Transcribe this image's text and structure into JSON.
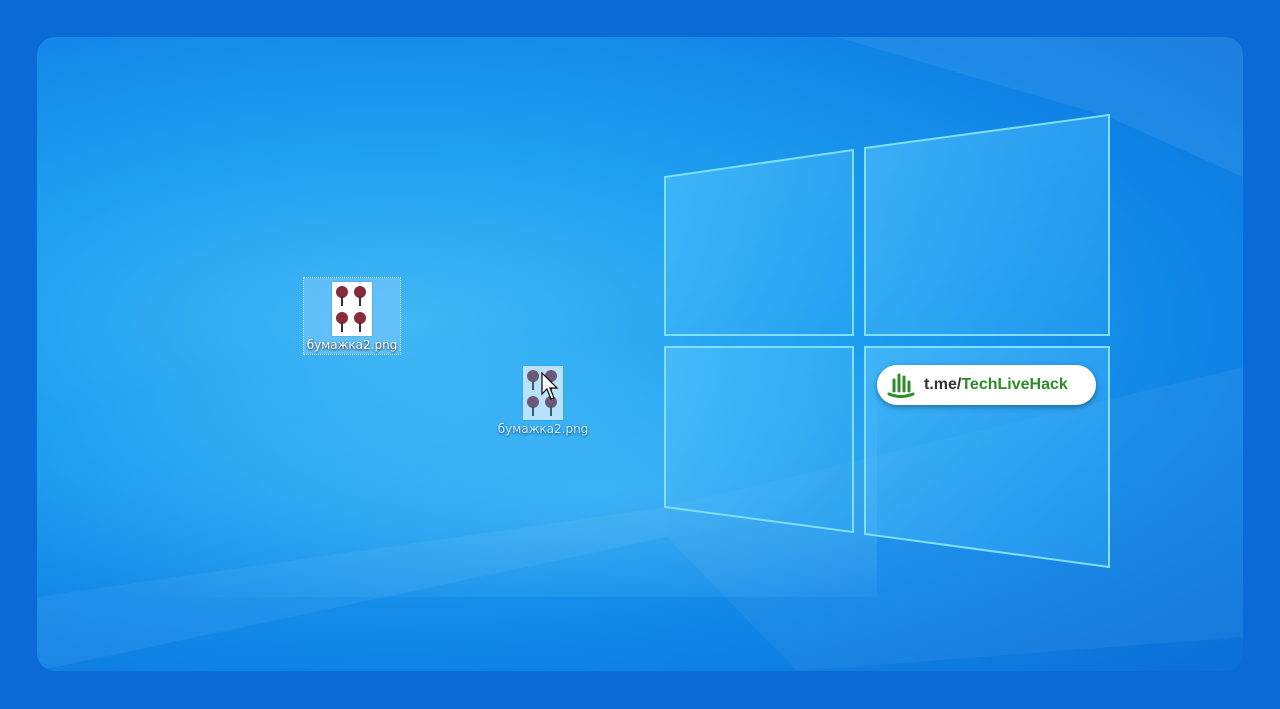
{
  "desktop": {
    "icons": [
      {
        "label": "бумажка2.png",
        "state": "selected"
      },
      {
        "label": "бумажка2.png",
        "state": "dragging"
      }
    ]
  },
  "watermark": {
    "prefix": "t.me/",
    "brand": "TechLiveHack"
  },
  "colors": {
    "background": "#0a6ad6",
    "wallpaper_light": "#41b8f6",
    "wallpaper_dark": "#0b6fd8",
    "brand_green": "#2e8b2a"
  },
  "icon_names": [
    "image-file-icon",
    "mouse-cursor-icon",
    "techlivehack-logo-icon",
    "windows-logo"
  ]
}
